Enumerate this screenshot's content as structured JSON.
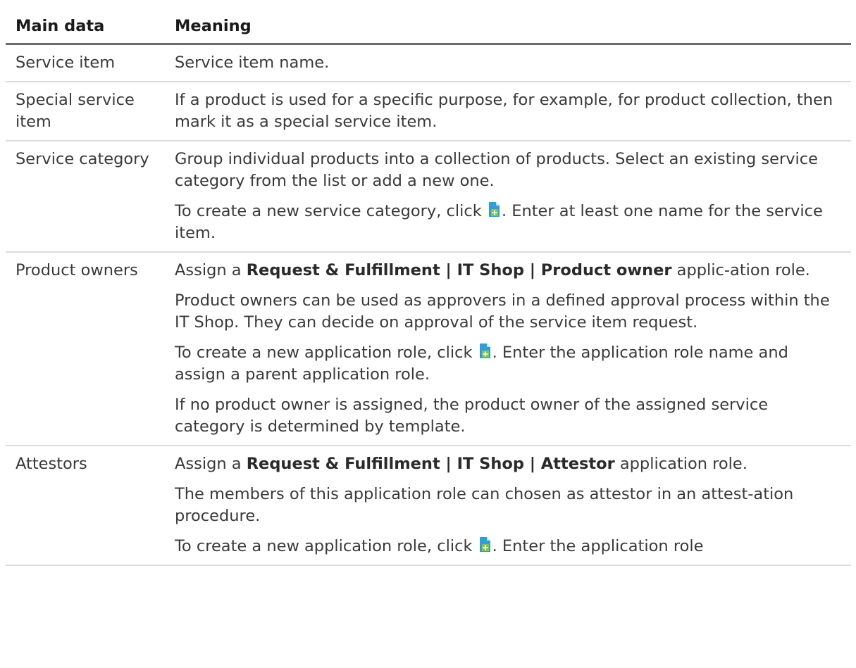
{
  "table": {
    "headers": [
      "Main data",
      "Meaning"
    ],
    "rows": [
      {
        "key": "Service item",
        "paragraphs": [
          [
            {
              "t": "Service item name."
            }
          ]
        ]
      },
      {
        "key": "Special service item",
        "paragraphs": [
          [
            {
              "t": "If a product is used for a specific purpose, for example, for product collection, then mark it as a special service item."
            }
          ]
        ]
      },
      {
        "key": "Service category",
        "paragraphs": [
          [
            {
              "t": "Group individual products into a collection of products. Select an existing service category from the list or add a new one."
            }
          ],
          [
            {
              "t": "To create a new service category, click "
            },
            {
              "icon": "add-document-icon"
            },
            {
              "t": ". Enter at least one name for the service item."
            }
          ]
        ]
      },
      {
        "key": "Product owners",
        "paragraphs": [
          [
            {
              "t": "Assign a "
            },
            {
              "b": "Request & Fulfillment | IT Shop | Product owner"
            },
            {
              "t": " applic-ation role."
            }
          ],
          [
            {
              "t": "Product owners can be used as approvers in a defined approval process within the IT Shop. They can decide on approval of the service item request."
            }
          ],
          [
            {
              "t": "To create a new application role, click "
            },
            {
              "icon": "add-document-icon"
            },
            {
              "t": ". Enter the application role name and assign a parent application role."
            }
          ],
          [
            {
              "t": "If no product owner is assigned, the product owner of the assigned service category is determined by template."
            }
          ]
        ]
      },
      {
        "key": "Attestors",
        "paragraphs": [
          [
            {
              "t": "Assign a "
            },
            {
              "b": "Request & Fulfillment | IT Shop | Attestor"
            },
            {
              "t": " application role."
            }
          ],
          [
            {
              "t": "The members of this application role can chosen as attestor in an attest-ation procedure."
            }
          ],
          [
            {
              "t": "To create a new application role, click "
            },
            {
              "icon": "add-document-icon"
            },
            {
              "t": ". Enter the application role"
            }
          ]
        ]
      }
    ]
  },
  "colors": {
    "icon_page": "#2a9fd8",
    "icon_fold": "#bfe3f5",
    "icon_badge": "#8bc34a"
  }
}
